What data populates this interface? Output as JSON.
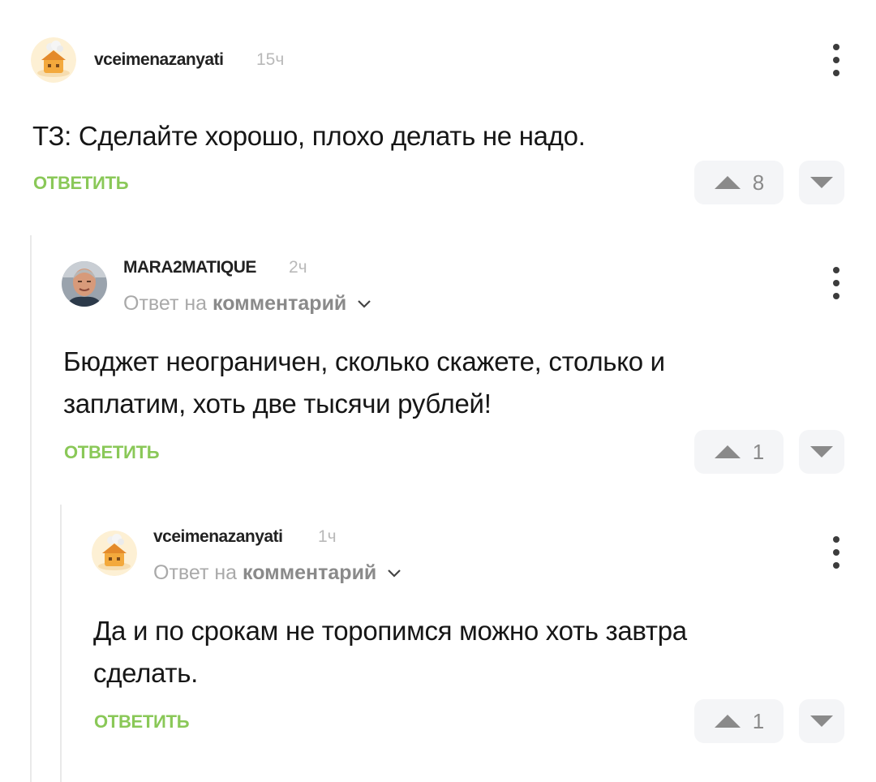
{
  "comments": [
    {
      "username": "vceimenazanyati",
      "time": "15ч",
      "text": "ТЗ: Сделайте хорошо, плохо делать не надо.",
      "reply_label": "ОТВЕТИТЬ",
      "votes": "8",
      "avatar": "cartoon-house-avatar"
    },
    {
      "username": "MARA2MATIQUE",
      "time": "2ч",
      "reply_prefix": "Ответ на",
      "reply_target": "комментарий",
      "text_line1": "Бюджет неограничен, сколько скажете, столько и",
      "text_line2": "заплатим, хоть две тысячи рублей!",
      "reply_label": "ОТВЕТИТЬ",
      "votes": "1",
      "avatar": "man-photo-avatar"
    },
    {
      "username": "vceimenazanyati",
      "time": "1ч",
      "reply_prefix": "Ответ на",
      "reply_target": "комментарий",
      "text_line1": "Да и по срокам не торопимся можно хоть завтра",
      "text_line2": "сделать.",
      "reply_label": "ОТВЕТИТЬ",
      "votes": "1",
      "avatar": "cartoon-house-avatar"
    }
  ],
  "colors": {
    "accent_green": "#8ac858",
    "vote_bg": "#f4f5f7",
    "muted_text": "#a9a9a9"
  }
}
